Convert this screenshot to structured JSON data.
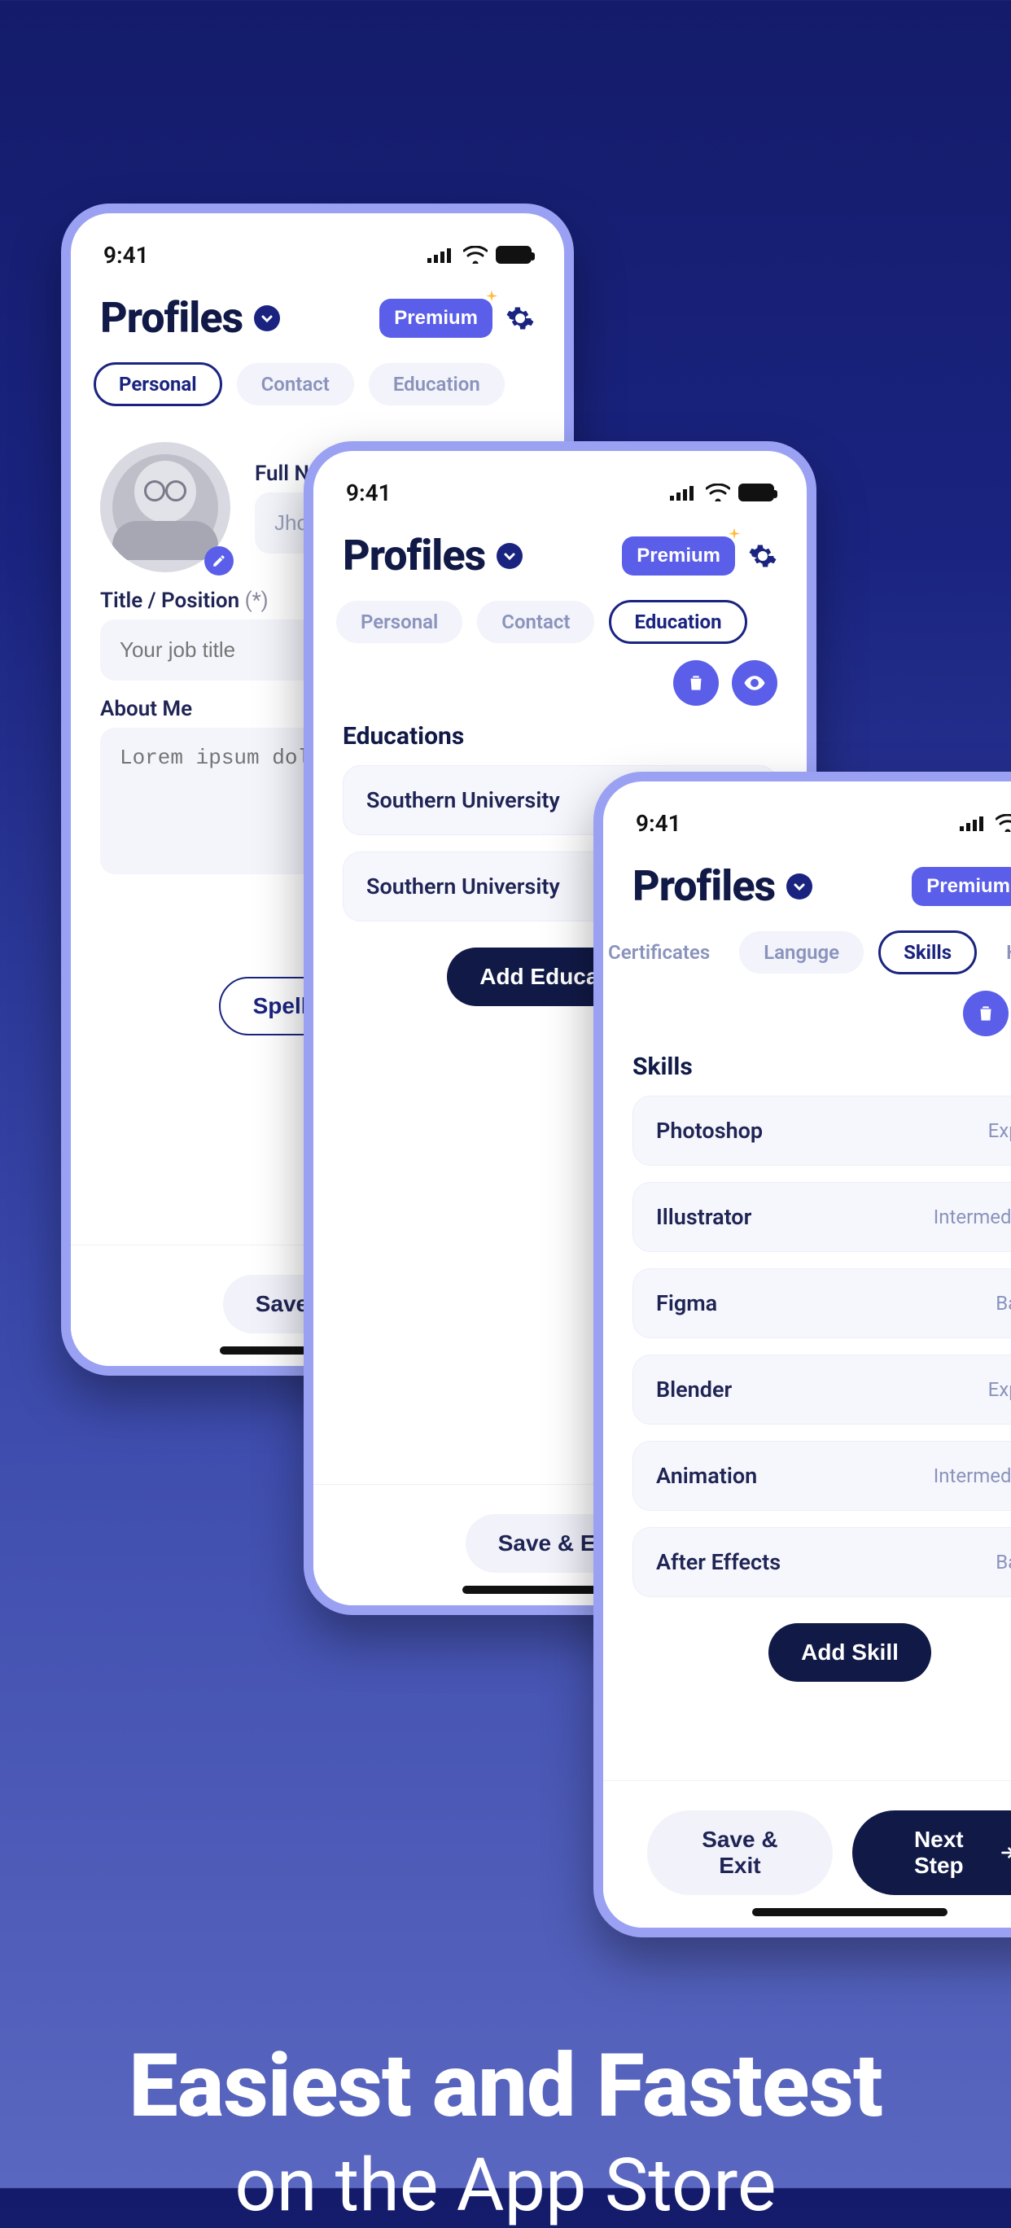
{
  "status": {
    "time": "9:41"
  },
  "header": {
    "title": "Profiles",
    "premium_label": "Premium"
  },
  "phone1": {
    "tabs": [
      "Personal",
      "Contact",
      "Education"
    ],
    "active_tab_index": 0,
    "fullname_label": "Full Name",
    "fullname_value": "Jhon",
    "title_label": "Title / Position",
    "title_required": "(*)",
    "title_placeholder": "Your job title",
    "about_label": "About Me",
    "about_placeholder": "Lorem ipsum dolor",
    "spellcheck_label": "Spell Check",
    "save_exit_label": "Save & Exit"
  },
  "phone2": {
    "tabs": [
      "Personal",
      "Contact",
      "Education"
    ],
    "active_tab_index": 2,
    "section_label": "Educations",
    "items": [
      {
        "name": "Southern University"
      },
      {
        "name": "Southern University"
      }
    ],
    "add_label": "Add Education",
    "save_exit_label": "Save & Exit"
  },
  "phone3": {
    "tabs": [
      "Certificates",
      "Languge",
      "Skills",
      "Hobbies"
    ],
    "active_tab_index": 2,
    "section_label": "Skills",
    "items": [
      {
        "name": "Photoshop",
        "level": "Expert"
      },
      {
        "name": "Illustrator",
        "level": "Intermediate"
      },
      {
        "name": "Figma",
        "level": "Basic"
      },
      {
        "name": "Blender",
        "level": "Expert"
      },
      {
        "name": "Animation",
        "level": "Intermediate"
      },
      {
        "name": "After Effects",
        "level": "Basic"
      }
    ],
    "add_label": "Add Skill",
    "save_exit_label": "Save & Exit",
    "next_step_label": "Next Step"
  },
  "marketing": {
    "line1": "Easiest and Fastest",
    "line2": "on the App Store"
  }
}
